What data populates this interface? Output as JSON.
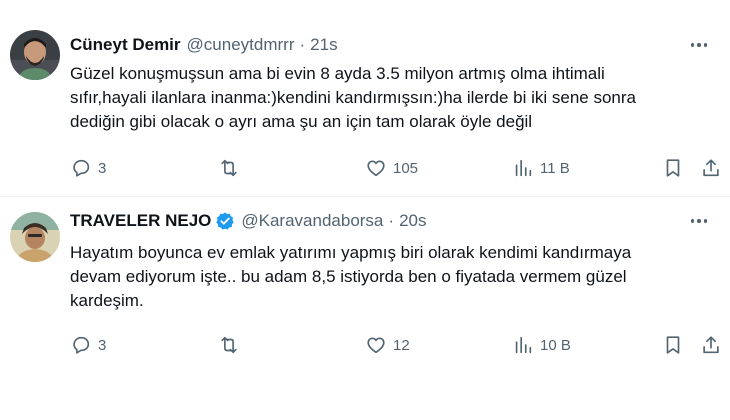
{
  "tweets": [
    {
      "display_name": "Cüneyt Demir",
      "handle": "@cuneytdmrrr",
      "separator": "·",
      "time": "21s",
      "verified": false,
      "text": "Güzel konuşmuşsun ama bi evin 8 ayda 3.5 milyon artmış olma ihtimali\nsıfır,hayali ilanlara inanma:)kendini kandırmışsın:)ha ilerde bi iki sene sonra\ndediğin gibi olacak o ayrı ama şu an için tam olarak öyle değil",
      "replies": "3",
      "retweets": "",
      "likes": "105",
      "views": "11 B"
    },
    {
      "display_name": "TRAVELER NEJO",
      "handle": "@Karavandaborsa",
      "separator": "·",
      "time": "20s",
      "verified": true,
      "text": "Hayatım boyunca ev emlak yatırımı yapmış biri olarak kendimi kandırmaya\ndevam ediyorum işte..  bu adam 8,5 istiyorda ben o fiyatada vermem güzel\nkardeşim.",
      "replies": "3",
      "retweets": "",
      "likes": "12",
      "views": "10 B"
    }
  ],
  "colors": {
    "text": "#0f1419",
    "secondary": "#536471",
    "verified": "#1d9bf0",
    "divider": "#eff3f4"
  },
  "icons": [
    "reply-icon",
    "retweet-icon",
    "like-icon",
    "views-icon",
    "bookmark-icon",
    "share-icon",
    "more-icon",
    "verified-icon"
  ]
}
